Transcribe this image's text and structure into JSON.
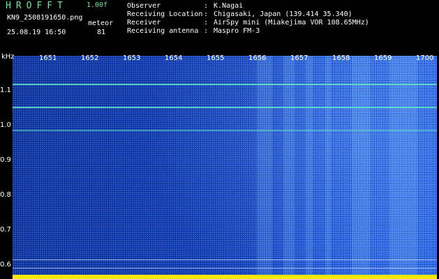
{
  "header": {
    "app_name": "HROFFT",
    "version": "1.00f",
    "filename": "KN9_2508191650.png",
    "timestamp": "25.08.19 16:50",
    "meteor_label": "meteor",
    "meteor_count": "81"
  },
  "info": {
    "observer_label": "Observer",
    "observer_value": "K.Nagai",
    "location_label": "Receiving Location",
    "location_value": "Chigasaki, Japan (139.414 35.340)",
    "receiver_label": "Receiver",
    "receiver_value": "AirSpy mini (Miakejima VOR 108.65MHz)",
    "antenna_label": "Receiving antenna",
    "antenna_value": "Maspro FM-3",
    "separator": ":"
  },
  "axis": {
    "unit": "kHz",
    "time_ticks": [
      "1651",
      "1652",
      "1653",
      "1654",
      "1655",
      "1656",
      "1657",
      "1658",
      "1659",
      "1700"
    ],
    "freq_ticks": [
      "1.1",
      "1.0",
      "0.9",
      "0.8",
      "0.7",
      "0.6"
    ]
  },
  "colors": {
    "background": "#000000",
    "title_green": "#7fe0a0",
    "text_white": "#ffffff",
    "spectrum_blue": "#1036b8",
    "line_cyan": "#5fe6c8",
    "bottom_yellow": "#ffe800"
  }
}
